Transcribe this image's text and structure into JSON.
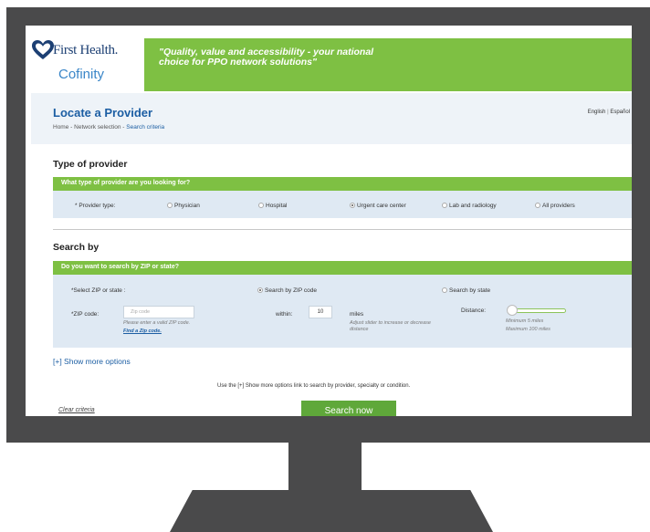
{
  "header": {
    "brand_primary": "First Health.",
    "brand_secondary": "Cofinity",
    "tagline": "\"Quality, value and accessibility - your national choice for PPO network solutions\"",
    "colors": {
      "green": "#7ec043",
      "navy": "#1c3f73",
      "blue": "#1c5ea3",
      "heart_red": "#c0282d"
    }
  },
  "page": {
    "title": "Locate a Provider",
    "breadcrumb": [
      "Home",
      "Network selection",
      "Search criteria"
    ],
    "breadcrumb_sep": "-",
    "language": {
      "english": "English",
      "sep": "|",
      "spanish": "Español"
    }
  },
  "provider_type_section": {
    "title": "Type of provider",
    "question": "What type of provider are you looking for?",
    "field_label": "* Provider type:",
    "options": [
      {
        "label": "Physician",
        "selected": false
      },
      {
        "label": "Hospital",
        "selected": false
      },
      {
        "label": "Urgent care center",
        "selected": true
      },
      {
        "label": "Lab and radiology",
        "selected": false
      },
      {
        "label": "All providers",
        "selected": false
      }
    ]
  },
  "search_by_section": {
    "title": "Search by",
    "question": "Do you want to search by ZIP or state?",
    "field_label": "*Select ZIP or state :",
    "options": [
      {
        "label": "Search by ZIP code",
        "selected": true
      },
      {
        "label": "Search by state",
        "selected": false
      }
    ],
    "zip": {
      "label": "*ZIP code:",
      "placeholder": "Zip code",
      "hint": "Please enter a valid ZIP code.",
      "find_link": "Find a Zip code."
    },
    "within": {
      "label": "within:",
      "value": "10",
      "unit": "miles",
      "hint": "Adjust slider to increase or decrease distance"
    },
    "distance": {
      "label": "Distance:",
      "min_text": "Minimum 5 miles",
      "max_text": "Maximum 100 miles",
      "slider_fraction": 0.0
    }
  },
  "more_options": {
    "link": "[+] Show more options",
    "help_text": "Use the [+] Show more options link to search by provider, specialty or condition."
  },
  "actions": {
    "clear": "Clear criteria",
    "search": "Search now"
  }
}
